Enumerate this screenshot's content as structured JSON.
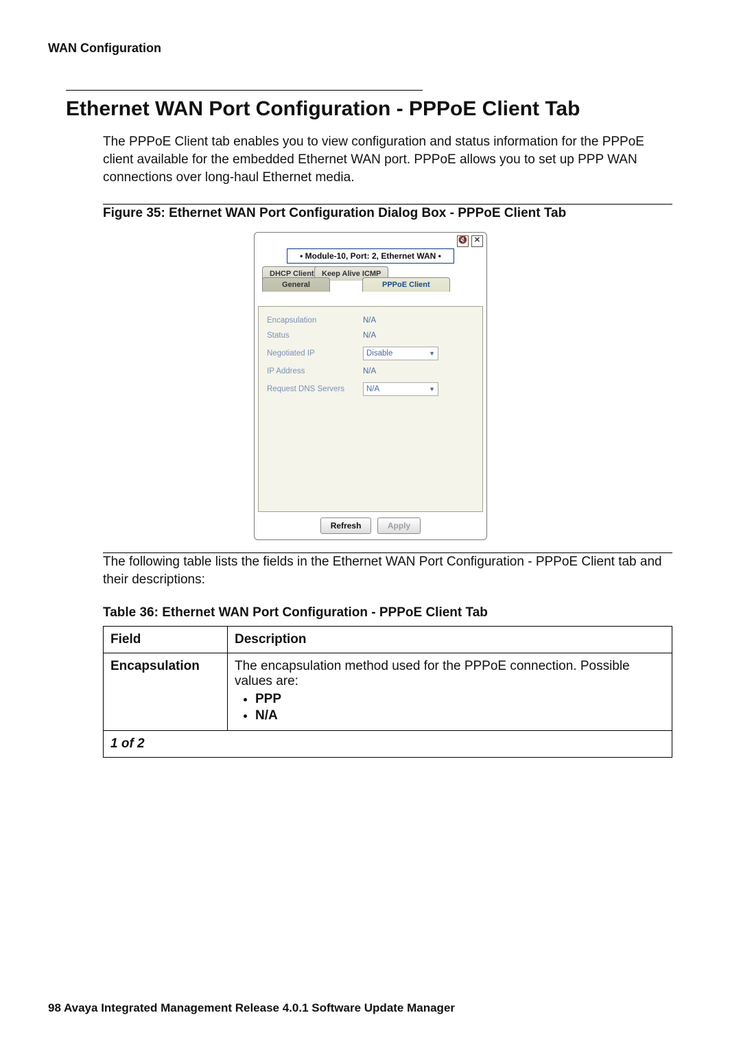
{
  "doc_header": "WAN Configuration",
  "section_title": "Ethernet WAN Port Configuration - PPPoE Client Tab",
  "intro_para": "The PPPoE Client tab enables you to view configuration and status information for the PPPoE client available for the embedded Ethernet WAN port. PPPoE allows you to set up PPP WAN connections over long-haul Ethernet media.",
  "figure_caption": "Figure 35: Ethernet WAN Port Configuration Dialog Box - PPPoE Client Tab",
  "dialog": {
    "title": "• Module-10, Port: 2, Ethernet WAN •",
    "sound_icon": "🔇",
    "close_icon": "✕",
    "tabs": {
      "dhcp": "DHCP Client",
      "keep": "Keep Alive ICMP",
      "general": "General",
      "pppoe": "PPPoE Client"
    },
    "rows": [
      {
        "label": "Encapsulation",
        "value": "N/A",
        "type": "text"
      },
      {
        "label": "Status",
        "value": "N/A",
        "type": "text"
      },
      {
        "label": "Negotiated IP",
        "value": "Disable",
        "type": "select"
      },
      {
        "label": "IP Address",
        "value": "N/A",
        "type": "text"
      },
      {
        "label": "Request DNS Servers",
        "value": "N/A",
        "type": "select"
      }
    ],
    "buttons": {
      "refresh": "Refresh",
      "apply": "Apply"
    }
  },
  "post_figure_para": "The following table lists the fields in the Ethernet WAN Port Configuration - PPPoE Client tab and their descriptions:",
  "table_caption": "Table 36: Ethernet WAN Port Configuration - PPPoE Client Tab",
  "table": {
    "header_field": "Field",
    "header_desc": "Description",
    "row_field": "Encapsulation",
    "row_desc_lead": "The encapsulation method used for the PPPoE connection. Possible values are:",
    "bullet1": "PPP",
    "bullet2": "N/A",
    "pager": "1 of 2"
  },
  "footer": "98   Avaya Integrated Management Release 4.0.1 Software Update Manager"
}
